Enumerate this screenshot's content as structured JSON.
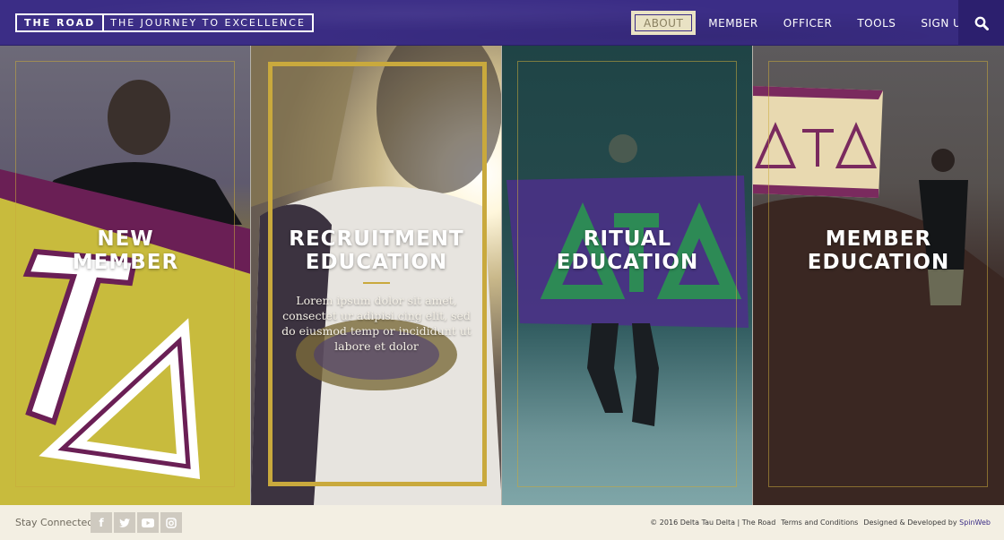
{
  "header": {
    "logo_main": "THE ROAD",
    "logo_sub": "THE JOURNEY TO EXCELLENCE",
    "nav": [
      {
        "label": "ABOUT",
        "active": true
      },
      {
        "label": "MEMBER",
        "active": false
      },
      {
        "label": "OFFICER",
        "active": false
      },
      {
        "label": "TOOLS",
        "active": false
      },
      {
        "label": "SIGN UP",
        "active": false
      }
    ],
    "search_icon": "search-icon"
  },
  "panels": [
    {
      "line1": "NEW",
      "line2": "MEMBER",
      "description": ""
    },
    {
      "line1": "RECRUITMENT",
      "line2": "EDUCATION",
      "description": "Lorem ipsum dolor sit amet, consectet ur adipisi cing elit, sed do eiusmod temp or incididunt ut labore et dolor"
    },
    {
      "line1": "RITUAL",
      "line2": "EDUCATION",
      "description": ""
    },
    {
      "line1": "MEMBER",
      "line2": "EDUCATION",
      "description": ""
    }
  ],
  "footer": {
    "stay_connected": "Stay Connected",
    "social": [
      "facebook-icon",
      "twitter-icon",
      "youtube-icon",
      "instagram-icon"
    ],
    "copyright": "© 2016 Delta Tau Delta | The Road",
    "terms": "Terms and Conditions",
    "designed_by": "Designed & Developed by",
    "developer": "SpinWeb"
  },
  "colors": {
    "brand_purple": "#3b2d86",
    "gold": "#c9a93d",
    "cream": "#f3efe3"
  }
}
